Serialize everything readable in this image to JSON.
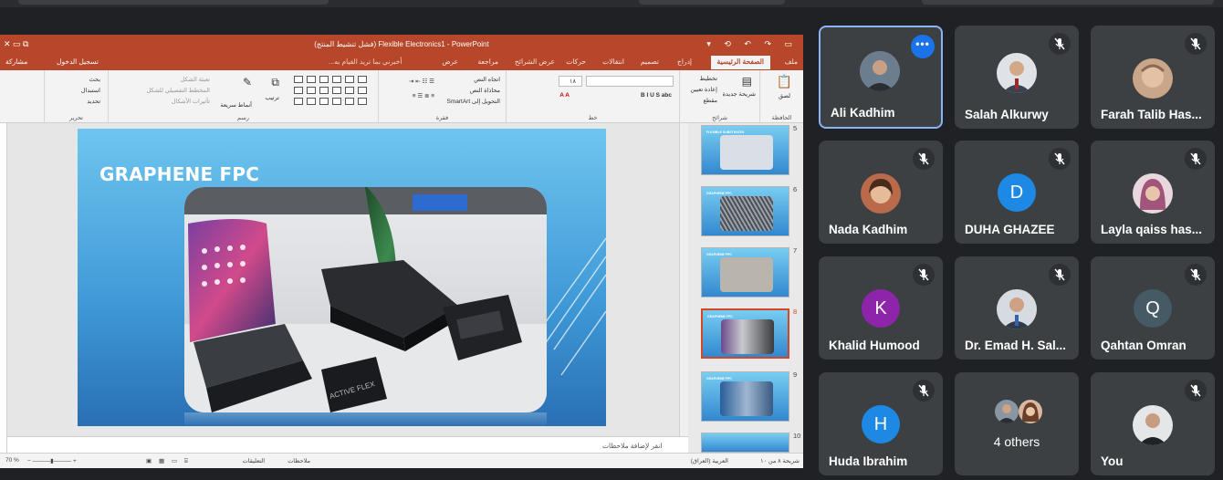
{
  "powerpoint": {
    "title": "Flexible Electronics1 - PowerPoint (فشل تنشيط المنتج)",
    "tabs": [
      "ملف",
      "الصفحة الرئيسية",
      "إدراج",
      "تصميم",
      "انتقالات",
      "حركات",
      "عرض الشرائح",
      "مراجعة",
      "عرض"
    ],
    "tell_me": "أخبرني بما تريد القيام به...",
    "sign_in": "تسجيل الدخول",
    "share": "مشاركة",
    "ribbon": {
      "paste": "لصق",
      "clipboard": "الحافظة",
      "new_slide": "شريحة جديدة",
      "layout": "تخطيط",
      "reset": "إعادة تعيين",
      "section": "مقطع",
      "slides": "شرائح",
      "font": "خط",
      "font_size": "١٨",
      "paragraph": "فقرة",
      "text_direction": "اتجاه النص",
      "align_text": "محاذاة النص",
      "smartart": "التحويل إلى SmartArt",
      "drawing": "رسم",
      "arrange": "ترتيب",
      "quick_styles": "أنماط سريعة",
      "shape_fill": "تعبئة الشكل",
      "shape_outline": "المخطط التفصيلي للشكل",
      "shape_effects": "تأثيرات الأشكال",
      "editing": "تحرير",
      "find": "بحث",
      "replace": "استبدال",
      "select": "تحديد"
    },
    "slide_title": "GRAPHENE FPC",
    "notes_placeholder": "انقر لإضافة ملاحظات",
    "thumbnails": [
      {
        "num": "5",
        "title": "FLEXIBLE SUBSTRATES"
      },
      {
        "num": "6",
        "title": "GRAPHENE FPC"
      },
      {
        "num": "7",
        "title": "GRAPHENE FPC"
      },
      {
        "num": "8",
        "title": "GRAPHENE FPC"
      },
      {
        "num": "9",
        "title": "GRAPHENE FPC"
      },
      {
        "num": "10",
        "title": ""
      }
    ],
    "photo_label_1": "ACTIVE FLEX",
    "status": {
      "slide_count": "شريحة ٨ من ١٠",
      "language": "العربية (العراق)",
      "notes": "ملاحظات",
      "comments": "التعليقات",
      "zoom": "70 %"
    }
  },
  "participants": [
    {
      "name": "Ali Kadhim",
      "type": "photo",
      "active": true
    },
    {
      "name": "Salah Alkurwy",
      "type": "photo"
    },
    {
      "name": "Farah Talib Has...",
      "type": "photo"
    },
    {
      "name": "Nada Kadhim",
      "type": "photo"
    },
    {
      "name": "DUHA GHAZEE",
      "type": "initial",
      "initial": "D",
      "color": "#1e88e5"
    },
    {
      "name": "Layla qaiss has...",
      "type": "photo"
    },
    {
      "name": "Khalid Humood",
      "type": "initial",
      "initial": "K",
      "color": "#8e24aa"
    },
    {
      "name": "Dr. Emad H. Sal...",
      "type": "photo"
    },
    {
      "name": "Qahtan Omran",
      "type": "initial",
      "initial": "Q",
      "color": "#455a64"
    },
    {
      "name": "Huda Ibrahim",
      "type": "initial",
      "initial": "H",
      "color": "#1e88e5"
    },
    {
      "name": "4 others",
      "type": "others"
    },
    {
      "name": "You",
      "type": "photo"
    }
  ],
  "colors": {
    "ppt_accent": "#b7472a",
    "tile_bg": "#3c4043",
    "meet_bg": "#202124",
    "active_border": "#8ab4f8",
    "more_button": "#1a73e8"
  }
}
